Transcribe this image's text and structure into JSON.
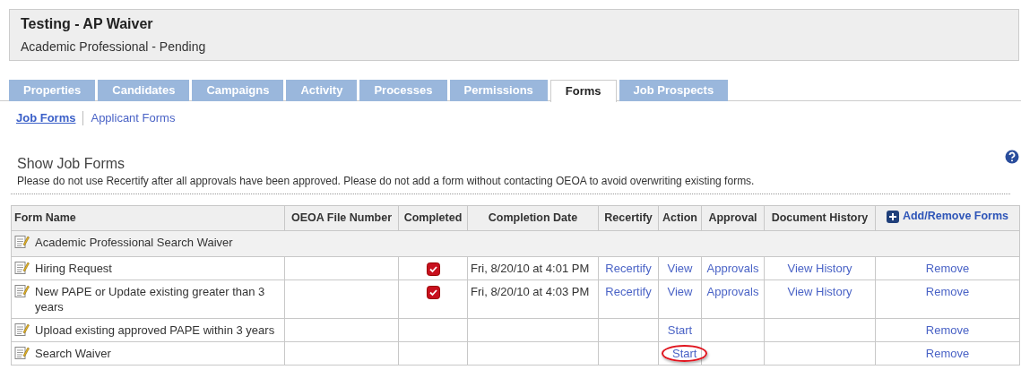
{
  "header": {
    "title": "Testing - AP Waiver",
    "subtitle": "Academic Professional - Pending"
  },
  "tabs": [
    {
      "label": "Properties",
      "selected": false
    },
    {
      "label": "Candidates",
      "selected": false
    },
    {
      "label": "Campaigns",
      "selected": false
    },
    {
      "label": "Activity",
      "selected": false
    },
    {
      "label": "Processes",
      "selected": false
    },
    {
      "label": "Permissions",
      "selected": false
    },
    {
      "label": "Forms",
      "selected": true
    },
    {
      "label": "Job Prospects",
      "selected": false
    }
  ],
  "subnav": [
    {
      "label": "Job Forms",
      "selected": true
    },
    {
      "label": "Applicant Forms",
      "selected": false
    }
  ],
  "section": {
    "title": "Show Job Forms",
    "notice": "Please do not use Recertify after all approvals have been approved. Please do not add a form without contacting OEOA to avoid overwriting existing forms."
  },
  "table": {
    "columns": [
      "Form Name",
      "OEOA File Number",
      "Completed",
      "Completion Date",
      "Recertify",
      "Action",
      "Approval",
      "Document History",
      "Add/Remove Forms"
    ],
    "group": "Academic Professional Search Waiver",
    "rows": [
      {
        "name": "Hiring Request",
        "completed": true,
        "completion_date": "Fri, 8/20/10 at 4:01 PM",
        "recertify": "Recertify",
        "action": "View",
        "action_circled": false,
        "approval": "Approvals",
        "history": "View History",
        "remove": "Remove"
      },
      {
        "name": "New PAPE or Update existing greater than 3 years",
        "completed": true,
        "completion_date": "Fri, 8/20/10 at 4:03 PM",
        "recertify": "Recertify",
        "action": "View",
        "action_circled": false,
        "approval": "Approvals",
        "history": "View History",
        "remove": "Remove"
      },
      {
        "name": "Upload existing approved PAPE within 3 years",
        "completed": false,
        "action": "Start",
        "action_circled": false,
        "remove": "Remove"
      },
      {
        "name": "Search Waiver",
        "completed": false,
        "action": "Start",
        "action_circled": true,
        "remove": "Remove"
      }
    ]
  }
}
